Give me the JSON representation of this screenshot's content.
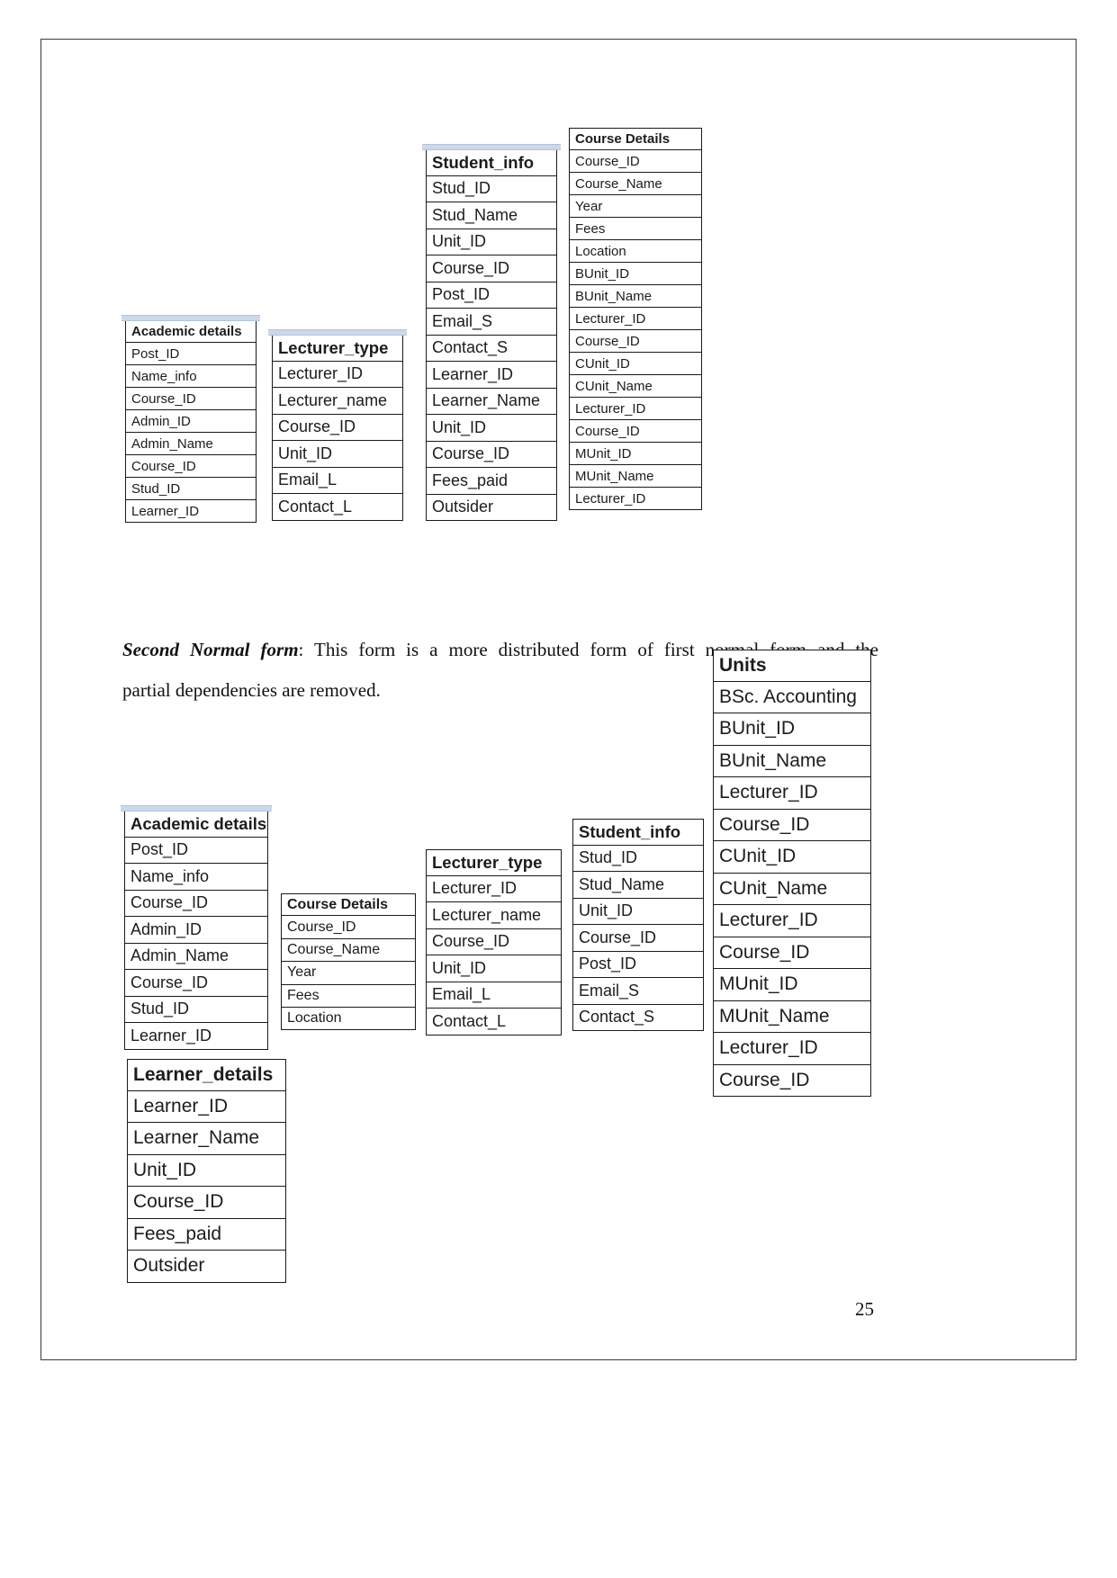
{
  "document": {
    "page_number": "25",
    "paragraph": {
      "lead": "Second Normal form",
      "line1": ": This form is a more distributed form of first normal form and the",
      "line2": "partial dependencies are removed.",
      "full": "Second Normal form: This form is a more distributed form of first normal form and the partial dependencies are removed."
    }
  },
  "first_normal_form_diagram": {
    "tables": [
      {
        "name": "academic-details",
        "title": "Academic details",
        "fields": [
          "Post_ID",
          "Name_info",
          "Course_ID",
          "Admin_ID",
          "Admin_Name",
          "Course_ID",
          "Stud_ID",
          "Learner_ID"
        ]
      },
      {
        "name": "lecturer-type",
        "title": "Lecturer_type",
        "fields": [
          "Lecturer_ID",
          "Lecturer_name",
          "Course_ID",
          "Unit_ID",
          "Email_L",
          "Contact_L"
        ]
      },
      {
        "name": "student-info",
        "title": "Student_info",
        "fields": [
          "Stud_ID",
          "Stud_Name",
          "Unit_ID",
          "Course_ID",
          "Post_ID",
          "Email_S",
          "Contact_S",
          "Learner_ID",
          "Learner_Name",
          "Unit_ID",
          "Course_ID",
          "Fees_paid",
          "Outsider"
        ]
      },
      {
        "name": "course-details",
        "title": "Course Details",
        "fields": [
          "Course_ID",
          "Course_Name",
          "Year",
          "Fees",
          "Location",
          "BUnit_ID",
          "BUnit_Name",
          "Lecturer_ID",
          "Course_ID",
          "CUnit_ID",
          "CUnit_Name",
          "Lecturer_ID",
          "Course_ID",
          "MUnit_ID",
          "MUnit_Name",
          "Lecturer_ID"
        ]
      }
    ]
  },
  "second_normal_form_diagram": {
    "tables": [
      {
        "name": "academic-details",
        "title": "Academic details",
        "fields": [
          "Post_ID",
          "Name_info",
          "Course_ID",
          "Admin_ID",
          "Admin_Name",
          "Course_ID",
          "Stud_ID",
          "Learner_ID"
        ]
      },
      {
        "name": "course-details",
        "title": "Course Details",
        "fields": [
          "Course_ID",
          "Course_Name",
          "Year",
          "Fees",
          "Location"
        ]
      },
      {
        "name": "lecturer-type",
        "title": "Lecturer_type",
        "fields": [
          "Lecturer_ID",
          "Lecturer_name",
          "Course_ID",
          "Unit_ID",
          "Email_L",
          "Contact_L"
        ]
      },
      {
        "name": "student-info",
        "title": "Student_info",
        "fields": [
          "Stud_ID",
          "Stud_Name",
          "Unit_ID",
          "Course_ID",
          "Post_ID",
          "Email_S",
          "Contact_S"
        ]
      },
      {
        "name": "units",
        "title": "Units",
        "fields": [
          "BSc. Accounting",
          "BUnit_ID",
          "BUnit_Name",
          "Lecturer_ID",
          "Course_ID",
          "CUnit_ID",
          "CUnit_Name",
          "Lecturer_ID",
          "Course_ID",
          "MUnit_ID",
          "MUnit_Name",
          "Lecturer_ID",
          "Course_ID"
        ]
      },
      {
        "name": "learner-details",
        "title": "Learner_details",
        "fields": [
          "Learner_ID",
          "Learner_Name",
          "Unit_ID",
          "Course_ID",
          "Fees_paid",
          "Outsider"
        ]
      }
    ]
  }
}
